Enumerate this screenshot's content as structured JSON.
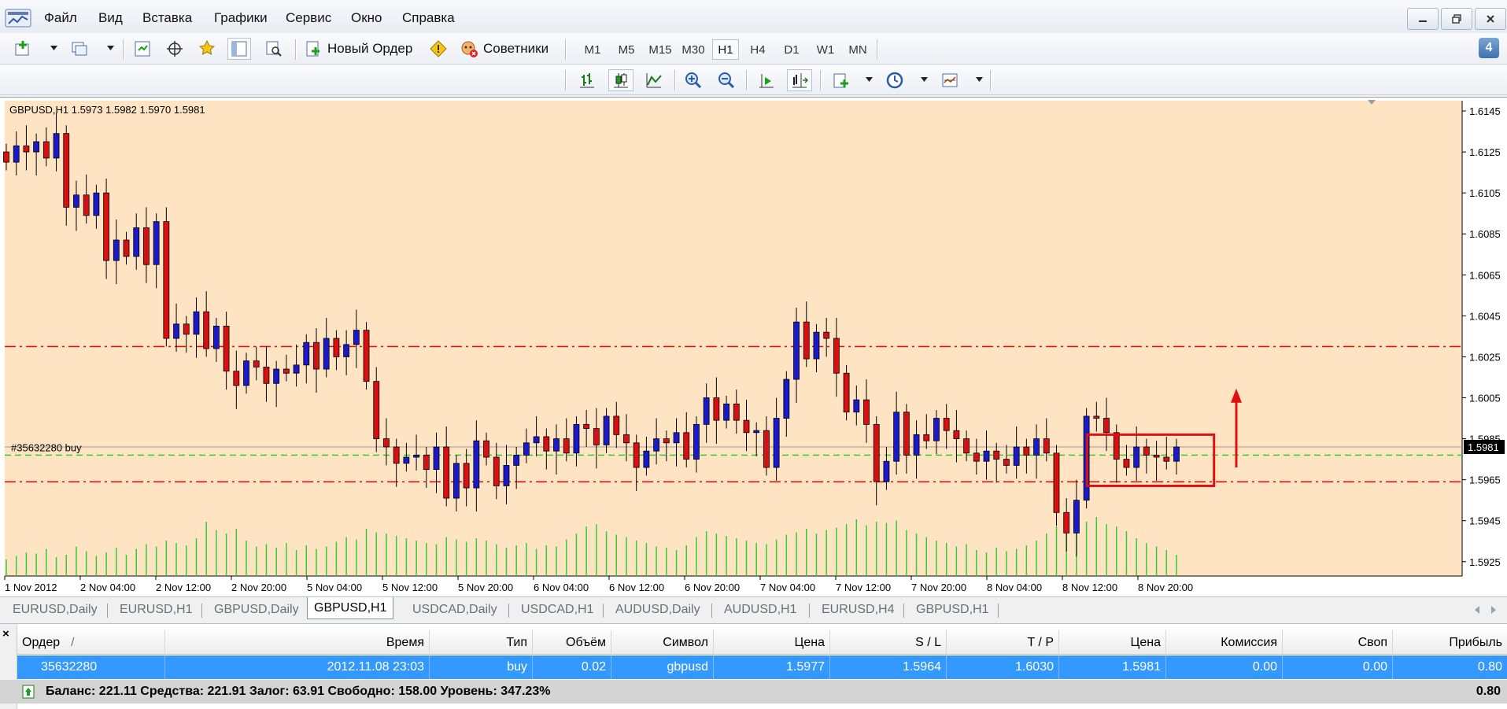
{
  "menu": {
    "items": [
      "Файл",
      "Вид",
      "Вставка",
      "Графики",
      "Сервис",
      "Окно",
      "Справка"
    ]
  },
  "toolbar1": {
    "new_order_label": "Новый Ордер",
    "advisors_label": "Советники",
    "timeframes": [
      "M1",
      "M5",
      "M15",
      "M30",
      "H1",
      "H4",
      "D1",
      "W1",
      "MN"
    ],
    "active_timeframe": "H1",
    "notification_count": "4"
  },
  "chart": {
    "title": "GBPUSD,H1  1.5973 1.5982 1.5970 1.5981",
    "price_axis": [
      "1.6145",
      "1.6125",
      "1.6105",
      "1.6085",
      "1.6065",
      "1.6045",
      "1.6025",
      "1.6005",
      "1.5985",
      "1.5965",
      "1.5945",
      "1.5925"
    ],
    "time_axis": [
      "1 Nov 2012",
      "2 Nov 04:00",
      "2 Nov 12:00",
      "2 Nov 20:00",
      "5 Nov 04:00",
      "5 Nov 12:00",
      "5 Nov 20:00",
      "6 Nov 04:00",
      "6 Nov 12:00",
      "6 Nov 20:00",
      "7 Nov 04:00",
      "7 Nov 12:00",
      "7 Nov 20:00",
      "8 Nov 04:00",
      "8 Nov 12:00",
      "8 Nov 20:00"
    ],
    "current_price": "1.5981",
    "order_label": "#35632280 buy",
    "order_price": 1.5977,
    "stop_loss": 1.5964,
    "take_profit": 1.603,
    "colors": {
      "background": "#ffe4c4",
      "bull_candle": "#1a1ac8",
      "bear_candle": "#d81010",
      "wick": "#000000",
      "volume": "#32cd32",
      "sl_tp_line": "#ff0000",
      "order_line": "#32cd32",
      "annotation": "#e01010"
    }
  },
  "chart_data": {
    "type": "candlestick",
    "title": "GBPUSD,H1  1.5973 1.5982 1.5970 1.5981",
    "ylim": [
      1.5918,
      1.615
    ],
    "x": [
      "1 Nov 2012",
      "2 Nov 04:00",
      "2 Nov 12:00",
      "2 Nov 20:00",
      "5 Nov 04:00",
      "5 Nov 12:00",
      "5 Nov 20:00",
      "6 Nov 04:00",
      "6 Nov 12:00",
      "6 Nov 20:00",
      "7 Nov 04:00",
      "7 Nov 12:00",
      "7 Nov 20:00",
      "8 Nov 04:00",
      "8 Nov 12:00",
      "8 Nov 20:00"
    ],
    "closes": [
      1.612,
      1.6128,
      1.6125,
      1.613,
      1.6122,
      1.6134,
      1.6098,
      1.6104,
      1.6094,
      1.6105,
      1.6072,
      1.6082,
      1.6074,
      1.6088,
      1.607,
      1.6091,
      1.6034,
      1.6041,
      1.6036,
      1.6047,
      1.6029,
      1.604,
      1.6018,
      1.6011,
      1.6023,
      1.602,
      1.6012,
      1.6019,
      1.6017,
      1.6021,
      1.6032,
      1.6019,
      1.6034,
      1.6025,
      1.6031,
      1.6038,
      1.6013,
      1.5985,
      1.5981,
      1.5973,
      1.5976,
      1.5977,
      1.597,
      1.5981,
      1.5956,
      1.5973,
      1.5961,
      1.5984,
      1.5976,
      1.5962,
      1.5972,
      1.5977,
      1.5983,
      1.5986,
      1.5979,
      1.5985,
      1.5978,
      1.5992,
      1.599,
      1.5982,
      1.5996,
      1.5987,
      1.5983,
      1.5971,
      1.5979,
      1.5985,
      1.5983,
      1.5988,
      1.5975,
      1.5992,
      1.6005,
      1.5994,
      1.6002,
      1.5994,
      1.5988,
      1.5989,
      1.5971,
      1.5995,
      1.6014,
      1.6042,
      1.6024,
      1.6037,
      1.6034,
      1.6017,
      1.5998,
      1.6004,
      1.5992,
      1.5964,
      1.5974,
      1.5998,
      1.5977,
      1.5987,
      1.5984,
      1.5995,
      1.5989,
      1.5985,
      1.5978,
      1.5974,
      1.5979,
      1.5975,
      1.5972,
      1.5981,
      1.5977,
      1.5985,
      1.5978,
      1.5949,
      1.5939,
      1.5955,
      1.5996,
      1.5995,
      1.5988,
      1.5975,
      1.5971,
      1.5981,
      1.5977,
      1.5976,
      1.5974,
      1.5981
    ],
    "volumes": [
      14,
      17,
      20,
      19,
      23,
      16,
      18,
      25,
      21,
      17,
      20,
      24,
      18,
      23,
      27,
      25,
      30,
      28,
      26,
      32,
      46,
      39,
      36,
      40,
      30,
      25,
      27,
      24,
      28,
      22,
      26,
      23,
      25,
      29,
      33,
      31,
      40,
      37,
      36,
      34,
      32,
      30,
      28,
      27,
      33,
      31,
      29,
      32,
      30,
      27,
      24,
      26,
      28,
      23,
      26,
      25,
      31,
      36,
      42,
      44,
      38,
      35,
      33,
      30,
      28,
      25,
      24,
      22,
      26,
      33,
      38,
      36,
      34,
      32,
      30,
      28,
      27,
      31,
      35,
      37,
      40,
      36,
      39,
      41,
      44,
      48,
      43,
      46,
      45,
      47,
      39,
      36,
      33,
      30,
      28,
      25,
      27,
      22,
      20,
      24,
      21,
      23,
      26,
      30,
      36,
      42,
      45,
      48,
      46,
      50,
      44,
      42,
      38,
      32,
      28,
      25,
      22,
      18
    ],
    "hlines": [
      {
        "name": "T/P",
        "value": 1.603
      },
      {
        "name": "S/L",
        "value": 1.5964
      },
      {
        "name": "order",
        "value": 1.5977
      },
      {
        "name": "bid",
        "value": 1.5981
      }
    ]
  },
  "tabs": {
    "items": [
      "EURUSD,Daily",
      "EURUSD,H1",
      "GBPUSD,Daily",
      "GBPUSD,H1",
      "USDCAD,Daily",
      "USDCAD,H1",
      "AUDUSD,Daily",
      "AUDUSD,H1",
      "EURUSD,H4",
      "GBPUSD,H1"
    ],
    "active_index": 3
  },
  "terminal": {
    "close_glyph": "×",
    "headers": {
      "order": "Ордер",
      "sort_mark": "/",
      "time": "Время",
      "type": "Тип",
      "volume": "Объём",
      "symbol": "Символ",
      "price": "Цена",
      "sl": "S / L",
      "tp": "T / P",
      "current_price": "Цена",
      "commission": "Комиссия",
      "swap": "Своп",
      "profit": "Прибыль"
    },
    "order": {
      "order": "35632280",
      "time": "2012.11.08 23:03",
      "type": "buy",
      "volume": "0.02",
      "symbol": "gbpusd",
      "price": "1.5977",
      "sl": "1.5964",
      "tp": "1.6030",
      "current_price": "1.5981",
      "commission": "0.00",
      "swap": "0.00",
      "profit": "0.80"
    },
    "balance": {
      "text": "Баланс: 221.11  Средства: 221.91  Залог: 63.91  Свободно: 158.00  Уровень: 347.23%",
      "profit": "0.80"
    }
  }
}
